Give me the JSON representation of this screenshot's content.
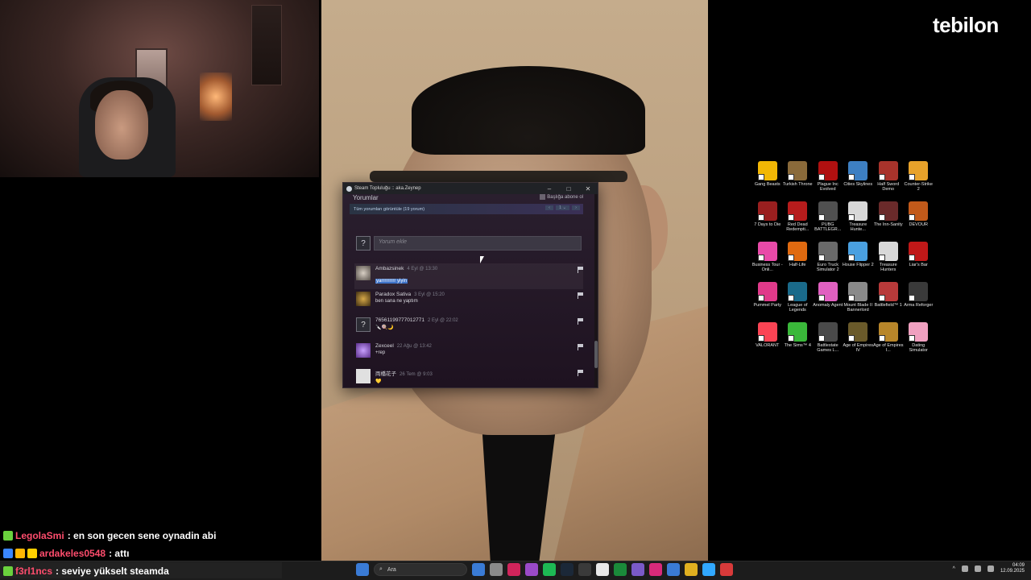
{
  "logo": "tebilon",
  "steam_window": {
    "title": "Steam Topluluğu :: aka.Zeynep",
    "minimize": "–",
    "maximize": "□",
    "close": "✕",
    "section_title": "Yorumlar",
    "subscribe_label": "Başlığa abone ol",
    "view_all": "Tüm yorumları görüntüle (19 yorum)",
    "pager": [
      "‹",
      "1 ⌄",
      "›"
    ],
    "comment_placeholder": "Yorum ekle",
    "comments": [
      {
        "author": "Ambazsinek",
        "time": "4 Eyl @ 13:30",
        "text": "yarrrrrrrrr yiyin"
      },
      {
        "author": "Paradox Sativa",
        "time": "3 Eyl @ 15:20",
        "text": "ben sana ne yaptım"
      },
      {
        "author": "76561199777012771",
        "time": "2 Eyl @ 22:02",
        "text": "🔪🍭🌙"
      },
      {
        "author": "Zexceel",
        "time": "22 Ağu @ 13:42",
        "text": "+rep"
      },
      {
        "author": "両橋花子",
        "time": "26 Tem @ 9:03",
        "text": "💛"
      }
    ]
  },
  "desktop_icons": [
    {
      "label": "Gang Beasts",
      "color": "#f2b705"
    },
    {
      "label": "Turkish Throne",
      "color": "#8a6a3a"
    },
    {
      "label": "Plague Inc Evolved",
      "color": "#b01010"
    },
    {
      "label": "Cities Skylines",
      "color": "#3d7fc2"
    },
    {
      "label": "Half Sword Demo",
      "color": "#a8332b"
    },
    {
      "label": "Counter-Strike 2",
      "color": "#e8a22a"
    },
    {
      "label": "7 Days to Die",
      "color": "#9a1f1f"
    },
    {
      "label": "Red Dead Redempti...",
      "color": "#b71c1c"
    },
    {
      "label": "PUBG BATTLEGR...",
      "color": "#505050"
    },
    {
      "label": "Treasure Hunte...",
      "color": "#d8d8d8"
    },
    {
      "label": "The Inn-Sanity",
      "color": "#6a2a2a"
    },
    {
      "label": "DEVOUR",
      "color": "#c25a1a"
    },
    {
      "label": "Business Tour - Onli...",
      "color": "#e84aa8"
    },
    {
      "label": "Half-Life",
      "color": "#e06a10"
    },
    {
      "label": "Euro Truck Simulator 2",
      "color": "#6a6a6a"
    },
    {
      "label": "House Flipper 2",
      "color": "#4aa0e0"
    },
    {
      "label": "Treasure Hunters",
      "color": "#d8d8d8"
    },
    {
      "label": "Liar's Bar",
      "color": "#c01818"
    },
    {
      "label": "Pummel Party",
      "color": "#e03a8a"
    },
    {
      "label": "League of Legends",
      "color": "#1a6a8a"
    },
    {
      "label": "Anomaly Agent",
      "color": "#e060c0"
    },
    {
      "label": "Mount Blade II Bannerlord",
      "color": "#8a8a8a"
    },
    {
      "label": "Battlefield™ 1",
      "color": "#b83a3a"
    },
    {
      "label": "Arma Reforger",
      "color": "#3a3a3a"
    },
    {
      "label": "VALORANT",
      "color": "#fa4454"
    },
    {
      "label": "The Sims™ 4",
      "color": "#3ab83a"
    },
    {
      "label": "Battlestate Games L...",
      "color": "#4a4a4a"
    },
    {
      "label": "Age of Empires IV",
      "color": "#6a5a2a"
    },
    {
      "label": "Age of Empires I...",
      "color": "#b8862a"
    },
    {
      "label": "Dating Simulator",
      "color": "#f0a0c0"
    }
  ],
  "chat": [
    {
      "user": "LegolaSmi",
      "user_color": "#ff4d6d",
      "badges": [
        "#6ad13d"
      ],
      "message": ": en son gecen sene oynadin abi"
    },
    {
      "user": "ardakeles0548",
      "user_color": "#ff4d6d",
      "badges": [
        "#3a86ff",
        "#ffb703",
        "#ffd000"
      ],
      "message": ": attı"
    },
    {
      "user": "f3rl1ncs",
      "user_color": "#ff4d6d",
      "badges": [
        "#6ad13d"
      ],
      "message": ": seviye yükselt steamda"
    }
  ],
  "taskbar": {
    "search_placeholder": "Ara",
    "apps": [
      "#3a7bd5",
      "#8a8a8a",
      "#d0245b",
      "#9a4ac8",
      "#1db954",
      "#1b2838",
      "#3a3a3a",
      "#e8e8e8",
      "#1a8a3a",
      "#7a5ac8",
      "#d82a7a",
      "#3a7bd5",
      "#e0b020",
      "#31a8ff",
      "#d83a3a"
    ],
    "time": "04:09",
    "date": "12.09.2025"
  }
}
